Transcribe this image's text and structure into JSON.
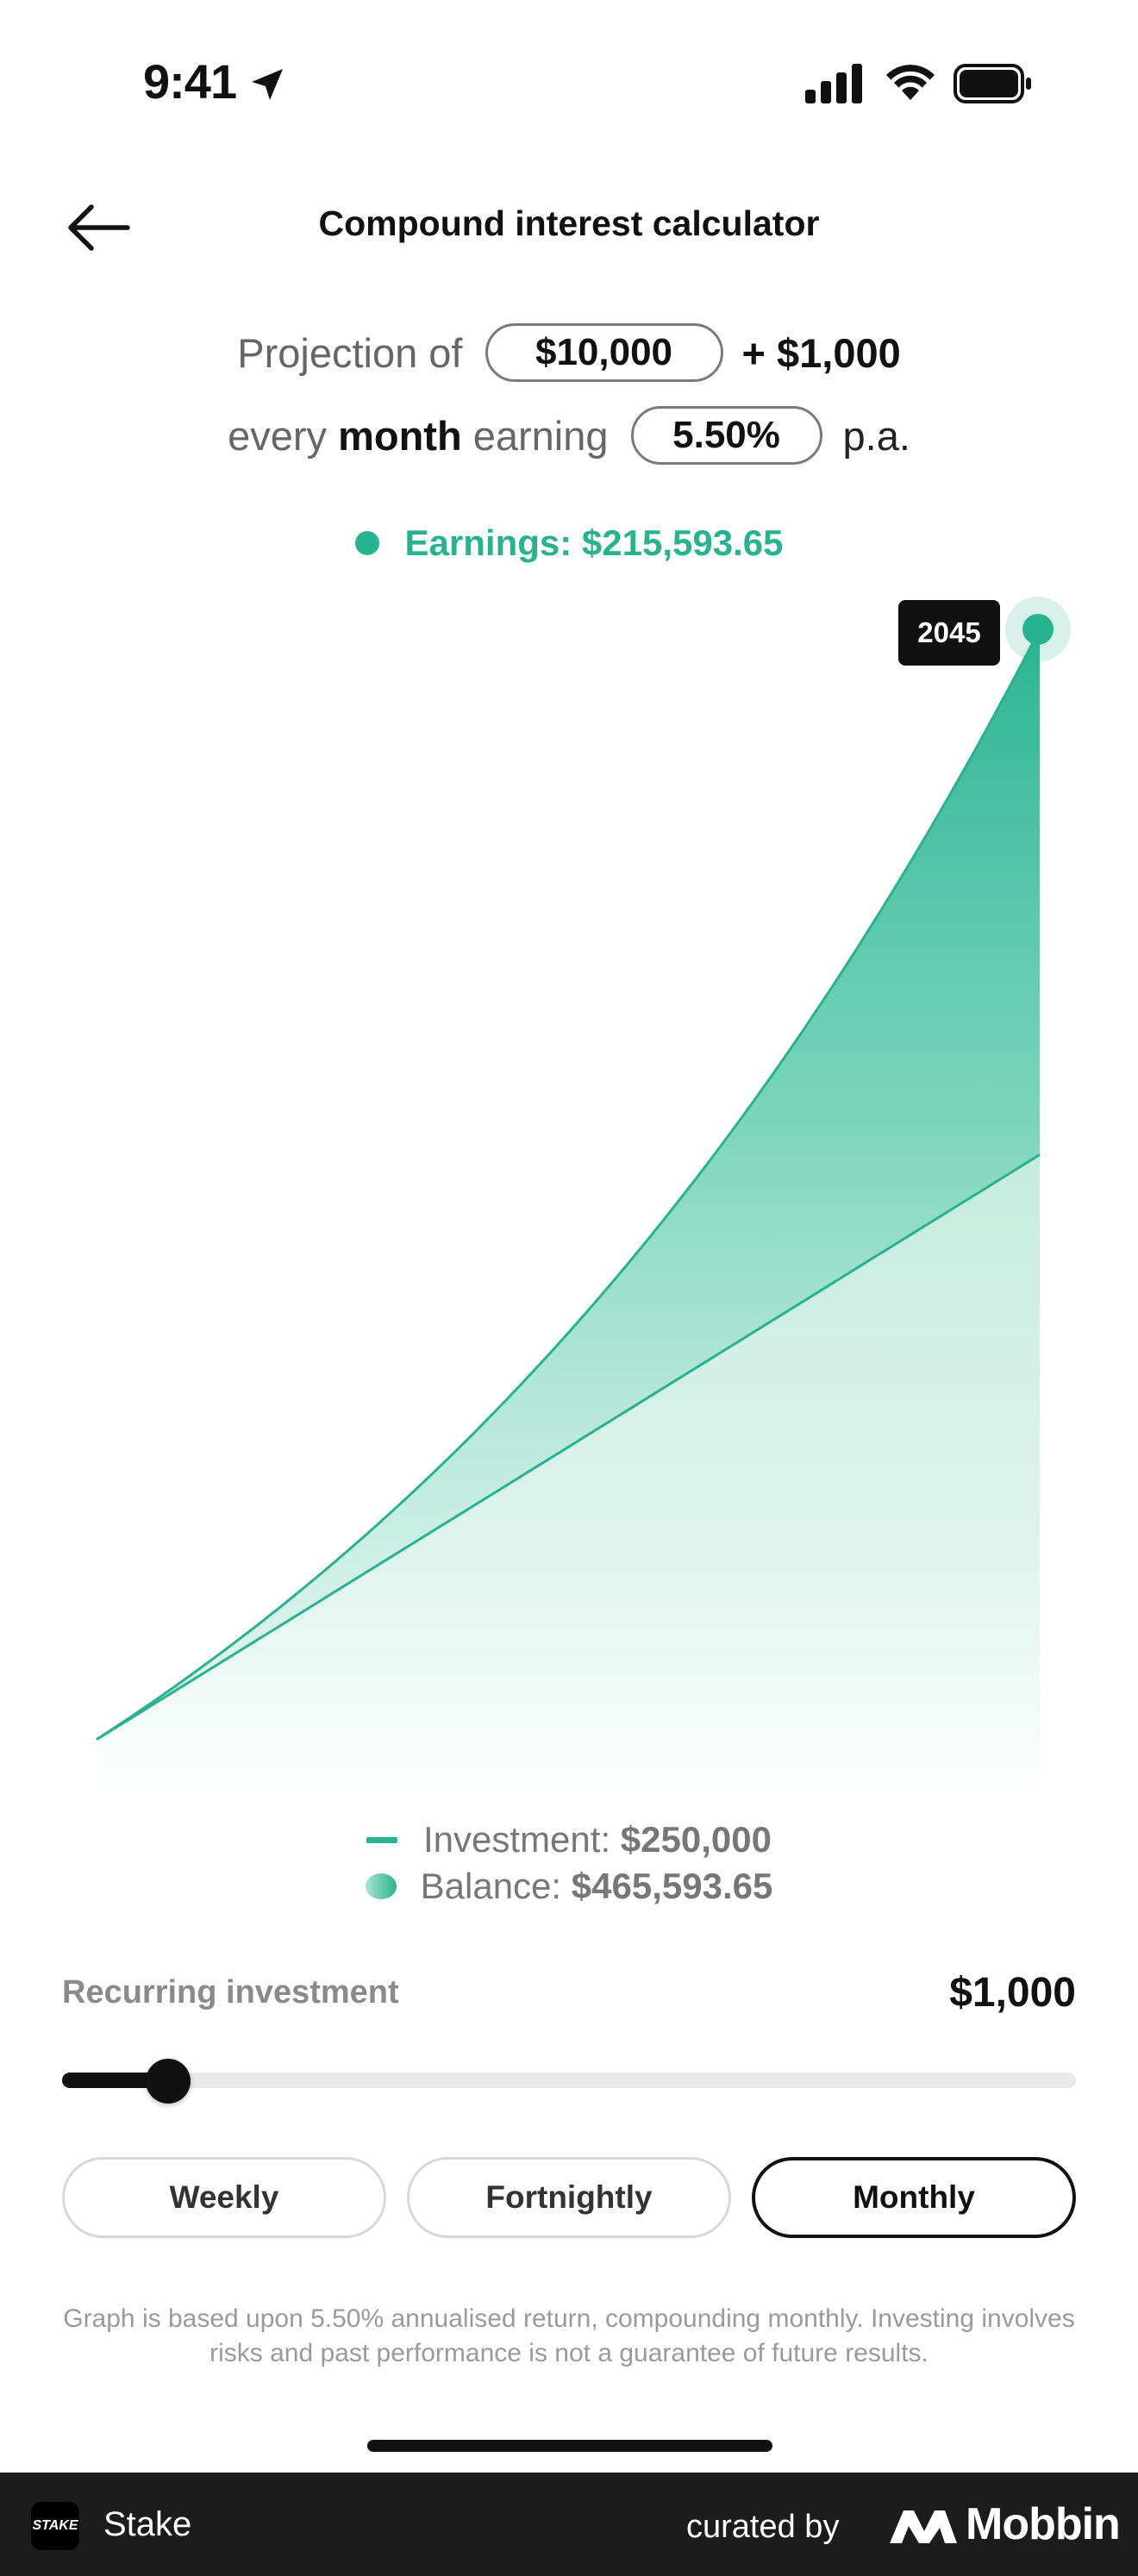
{
  "status_bar": {
    "time": "9:41"
  },
  "header": {
    "title": "Compound interest calculator"
  },
  "projection": {
    "prefix": "Projection of",
    "initial_amount": "$10,000",
    "plus_amount": "+ $1,000",
    "every": "every",
    "frequency_word": "month",
    "earning": "earning",
    "rate": "5.50%",
    "suffix": "p.a."
  },
  "earnings_label": "Earnings: $215,593.65",
  "chart_data": {
    "type": "area",
    "end_year": "2045",
    "series": [
      {
        "name": "Investment",
        "start": 10000,
        "end": 250000
      },
      {
        "name": "Balance",
        "start": 10000,
        "end": 465593.65
      }
    ],
    "earnings": 215593.65,
    "rate_pa": 5.5,
    "monthly_contribution": 1000,
    "grid": false
  },
  "legend": {
    "investment_label": "Investment:",
    "investment_value": "$250,000",
    "balance_label": "Balance:",
    "balance_value": "$465,593.65"
  },
  "recurring": {
    "label": "Recurring investment",
    "value": "$1,000",
    "slider_fraction": 0.105
  },
  "frequency": {
    "options": [
      "Weekly",
      "Fortnightly",
      "Monthly"
    ],
    "selected": "Monthly"
  },
  "disclaimer": "Graph is based upon 5.50% annualised return, compounding monthly. Investing involves risks and past performance is not a guarantee of future results.",
  "footer": {
    "app_name": "Stake",
    "logo_text": "STAKE",
    "curated_by": "curated by",
    "brand": "Mobbin"
  },
  "colors": {
    "accent": "#27b38f",
    "dark": "#111111",
    "footer_bg": "#1c1c1c"
  }
}
